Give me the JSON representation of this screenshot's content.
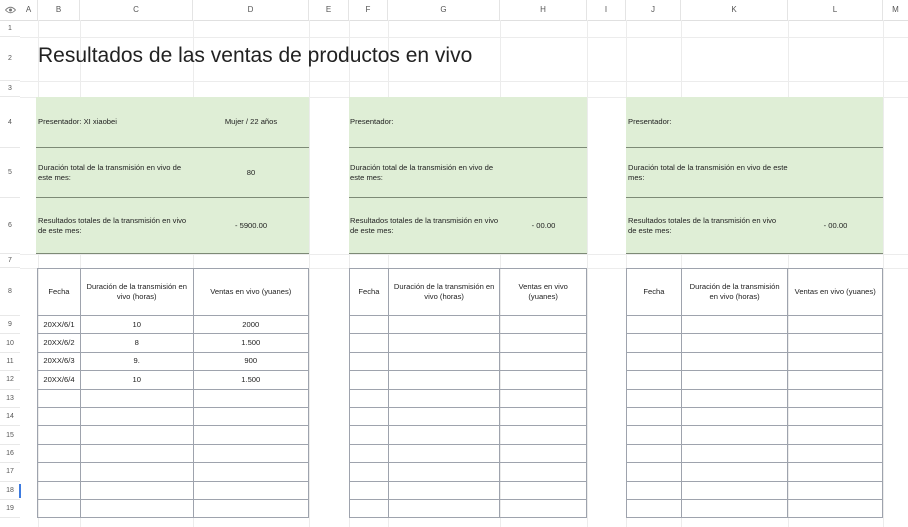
{
  "sheet": {
    "columns": [
      "A",
      "B",
      "C",
      "D",
      "E",
      "F",
      "G",
      "H",
      "I",
      "J",
      "K",
      "L",
      "M"
    ],
    "rows": [
      "1",
      "2",
      "3",
      "4",
      "5",
      "6",
      "7",
      "8",
      "9",
      "10",
      "11",
      "12",
      "13",
      "14",
      "15",
      "16",
      "17",
      "18",
      "19"
    ],
    "title": "Resultados de las ventas de productos en vivo"
  },
  "panels": [
    {
      "presenter_label": "Presentador: XI xiaobei",
      "presenter_info": "Mujer / 22 años",
      "duration_label": "Duración total de la transmisión en vivo de este mes:",
      "duration_value": "80",
      "results_label": "Resultados totales de la transmisión en vivo de este mes:",
      "results_value": "- 5900.00",
      "headers": [
        "Fecha",
        "Duración de la transmisión en vivo (horas)",
        "Ventas en vivo (yuanes)"
      ],
      "rows": [
        [
          "20XX/6/1",
          "10",
          "2000"
        ],
        [
          "20XX/6/2",
          "8",
          "1.500"
        ],
        [
          "20XX/6/3",
          "9.",
          "900"
        ],
        [
          "20XX/6/4",
          "10",
          "1.500"
        ],
        [
          "",
          "",
          ""
        ],
        [
          "",
          "",
          ""
        ],
        [
          "",
          "",
          ""
        ],
        [
          "",
          "",
          ""
        ],
        [
          "",
          "",
          ""
        ],
        [
          "",
          "",
          ""
        ],
        [
          "",
          "",
          ""
        ]
      ]
    },
    {
      "presenter_label": "Presentador:",
      "presenter_info": "",
      "duration_label": "Duración total de la transmisión en vivo de este mes:",
      "duration_value": "",
      "results_label": "Resultados totales de la transmisión en vivo de este mes:",
      "results_value": "- 00.00",
      "headers": [
        "Fecha",
        "Duración de la transmisión en vivo (horas)",
        "Ventas en vivo (yuanes)"
      ],
      "rows": [
        [
          "",
          "",
          ""
        ],
        [
          "",
          "",
          ""
        ],
        [
          "",
          "",
          ""
        ],
        [
          "",
          "",
          ""
        ],
        [
          "",
          "",
          ""
        ],
        [
          "",
          "",
          ""
        ],
        [
          "",
          "",
          ""
        ],
        [
          "",
          "",
          ""
        ],
        [
          "",
          "",
          ""
        ],
        [
          "",
          "",
          ""
        ],
        [
          "",
          "",
          ""
        ]
      ]
    },
    {
      "presenter_label": "Presentador:",
      "presenter_info": "",
      "duration_label": "Duración total de la transmisión en vivo de este mes:",
      "duration_value": "",
      "results_label": "Resultados totales de la transmisión en vivo de este mes:",
      "results_value": "- 00.00",
      "headers": [
        "Fecha",
        "Duración de la transmisión en vivo (horas)",
        "Ventas en vivo (yuanes)"
      ],
      "rows": [
        [
          "",
          "",
          ""
        ],
        [
          "",
          "",
          ""
        ],
        [
          "",
          "",
          ""
        ],
        [
          "",
          "",
          ""
        ],
        [
          "",
          "",
          ""
        ],
        [
          "",
          "",
          ""
        ],
        [
          "",
          "",
          ""
        ],
        [
          "",
          "",
          ""
        ],
        [
          "",
          "",
          ""
        ],
        [
          "",
          "",
          ""
        ],
        [
          "",
          "",
          ""
        ]
      ]
    }
  ]
}
